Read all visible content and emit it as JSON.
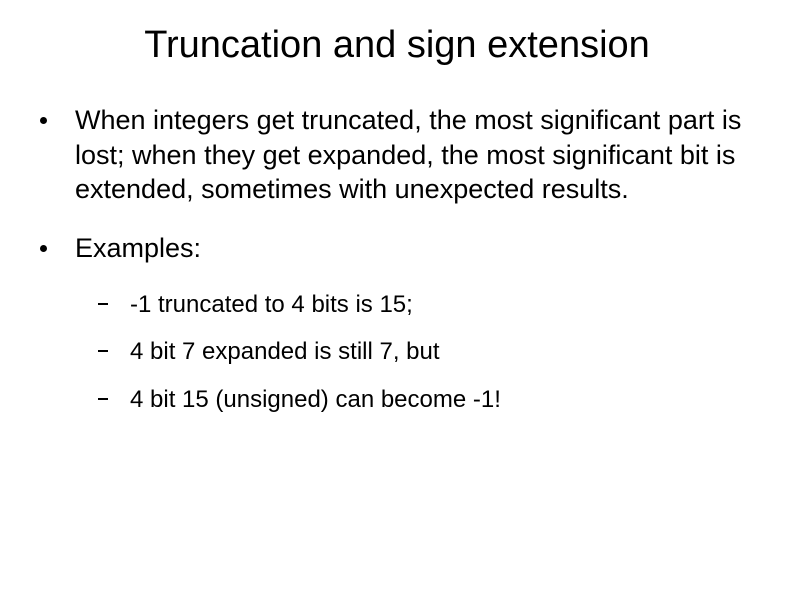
{
  "title": "Truncation and sign extension",
  "bullets": [
    {
      "text": "When integers get truncated, the most significant part is lost; when they get expanded, the most significant bit is extended, sometimes with unexpected results."
    },
    {
      "text": "Examples:",
      "subitems": [
        "-1 truncated to 4 bits is 15;",
        "4 bit 7 expanded is still 7, but",
        "4 bit 15 (unsigned) can become -1!"
      ]
    }
  ]
}
